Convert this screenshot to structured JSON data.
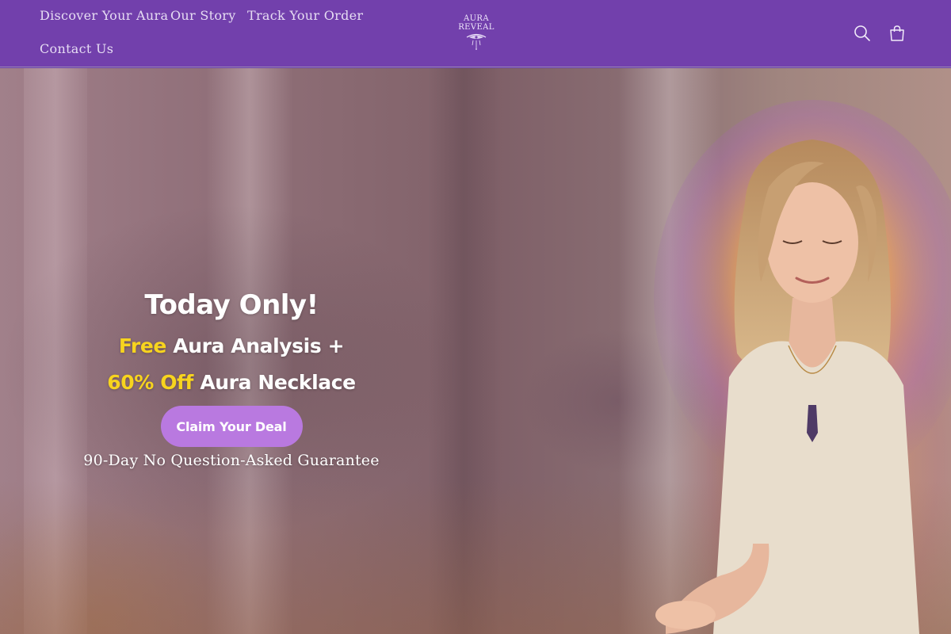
{
  "header": {
    "nav": [
      {
        "label": "Discover Your Aura"
      },
      {
        "label": "Our Story"
      },
      {
        "label": "Track Your Order"
      },
      {
        "label": "Contact Us"
      }
    ],
    "logo": {
      "line1": "AURA",
      "line2": "REVEAL",
      "icon": "aura-reveal-logo"
    },
    "icons": {
      "search": "search-icon",
      "cart": "cart-icon"
    },
    "background_color": "#7240ac"
  },
  "hero": {
    "title": "Today Only!",
    "offer_line1": {
      "accent": "Free",
      "rest": " Aura Analysis +"
    },
    "offer_line2": {
      "accent": "60% Off",
      "rest": " Aura Necklace"
    },
    "cta_label": "Claim Your Deal",
    "guarantee": "90-Day No Question-Asked Guarantee",
    "accent_color": "#f7d41e",
    "cta_color": "#b979e0",
    "image": "meditating-woman-with-aura-glow"
  }
}
